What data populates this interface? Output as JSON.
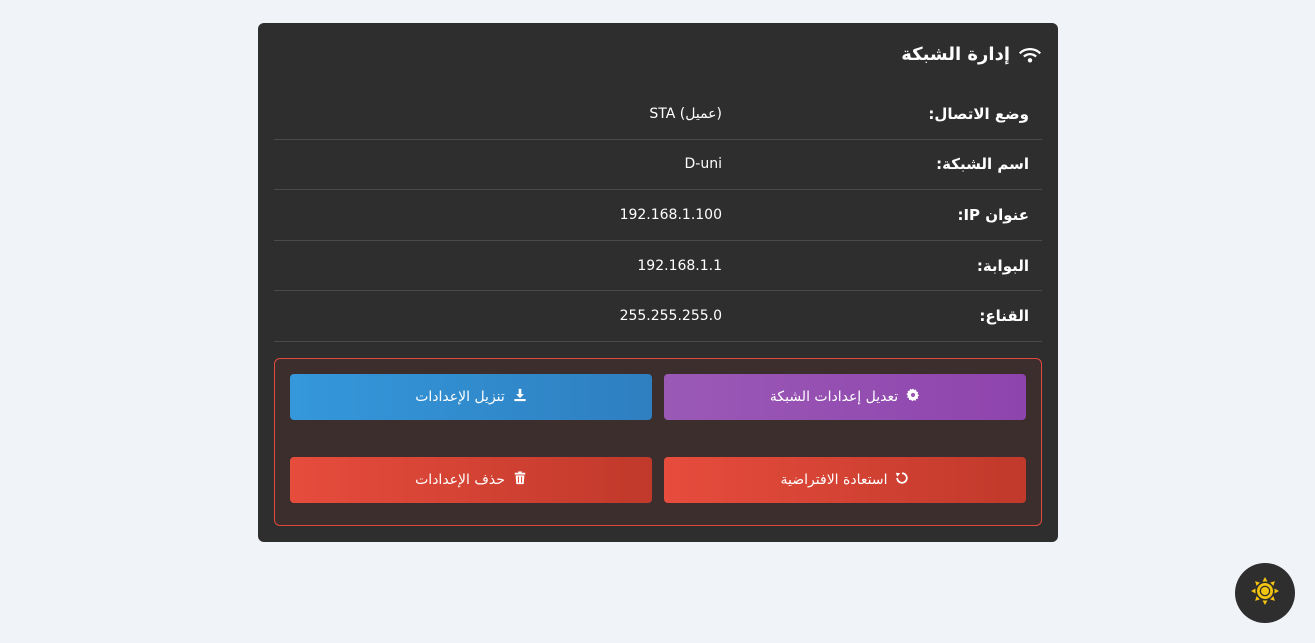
{
  "card": {
    "title": "إدارة الشبكة",
    "icon": "wifi-icon"
  },
  "info_rows": [
    {
      "label": "وضع الاتصال:",
      "value": "STA (عميل)"
    },
    {
      "label": "اسم الشبكة:",
      "value": "D-uni"
    },
    {
      "label": "عنوان IP:",
      "value": "192.168.1.100"
    },
    {
      "label": "البوابة:",
      "value": "192.168.1.1"
    },
    {
      "label": "القناع:",
      "value": "255.255.255.0"
    }
  ],
  "actions": {
    "edit_settings": {
      "label": "تعديل إعدادات الشبكة",
      "icon": "gear-icon"
    },
    "download_settings": {
      "label": "تنزيل الإعدادات",
      "icon": "download-icon"
    },
    "restore_defaults": {
      "label": "استعادة الافتراضية",
      "icon": "reset-icon"
    },
    "delete_settings": {
      "label": "حذف الإعدادات",
      "icon": "trash-icon"
    }
  },
  "theme_toggle": {
    "icon": "sun-icon"
  },
  "colors": {
    "page_bg": "#f0f3f8",
    "card_bg": "#2e2e2e",
    "purple": "#9b59b6",
    "blue": "#3498db",
    "red": "#e74c3c",
    "sun": "#f1c40f"
  }
}
